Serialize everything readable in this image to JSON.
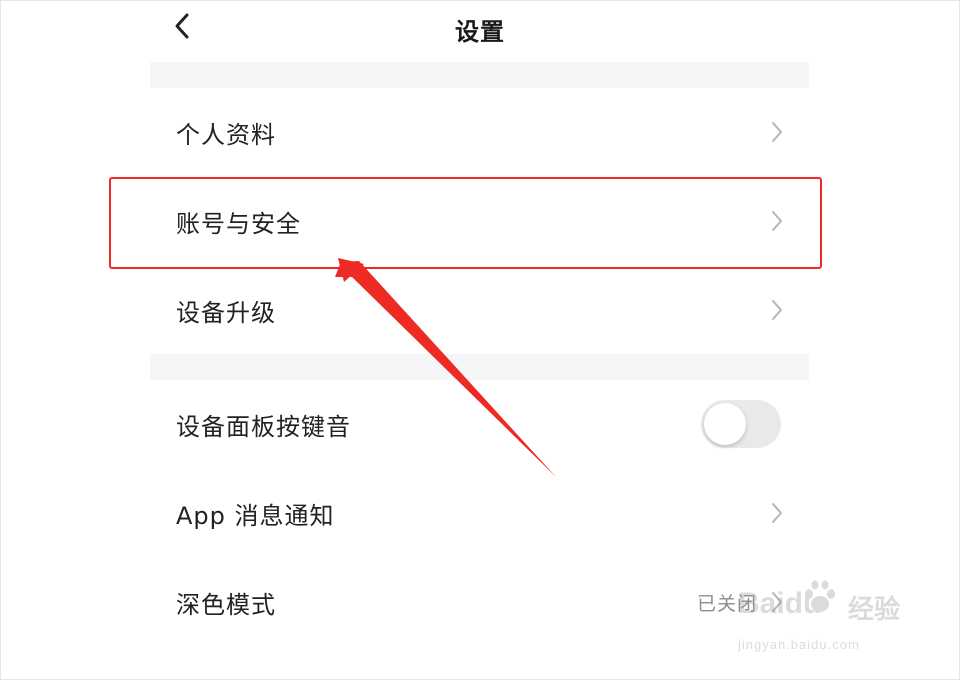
{
  "header": {
    "title": "设置",
    "back_icon": "chevron-left-icon"
  },
  "settings": {
    "items": [
      {
        "label": "个人资料",
        "type": "link"
      },
      {
        "label": "账号与安全",
        "type": "link",
        "highlighted": true
      },
      {
        "label": "设备升级",
        "type": "link"
      },
      {
        "label": "设备面板按键音",
        "type": "toggle",
        "on": false
      },
      {
        "label": "App 消息通知",
        "type": "link"
      },
      {
        "label": "深色模式",
        "type": "link",
        "value": "已关闭"
      }
    ]
  },
  "annotation": {
    "color": "#ee2a24"
  },
  "watermark": {
    "brand": "Baidu",
    "product": "经验",
    "url": "jingyan.baidu.com"
  }
}
